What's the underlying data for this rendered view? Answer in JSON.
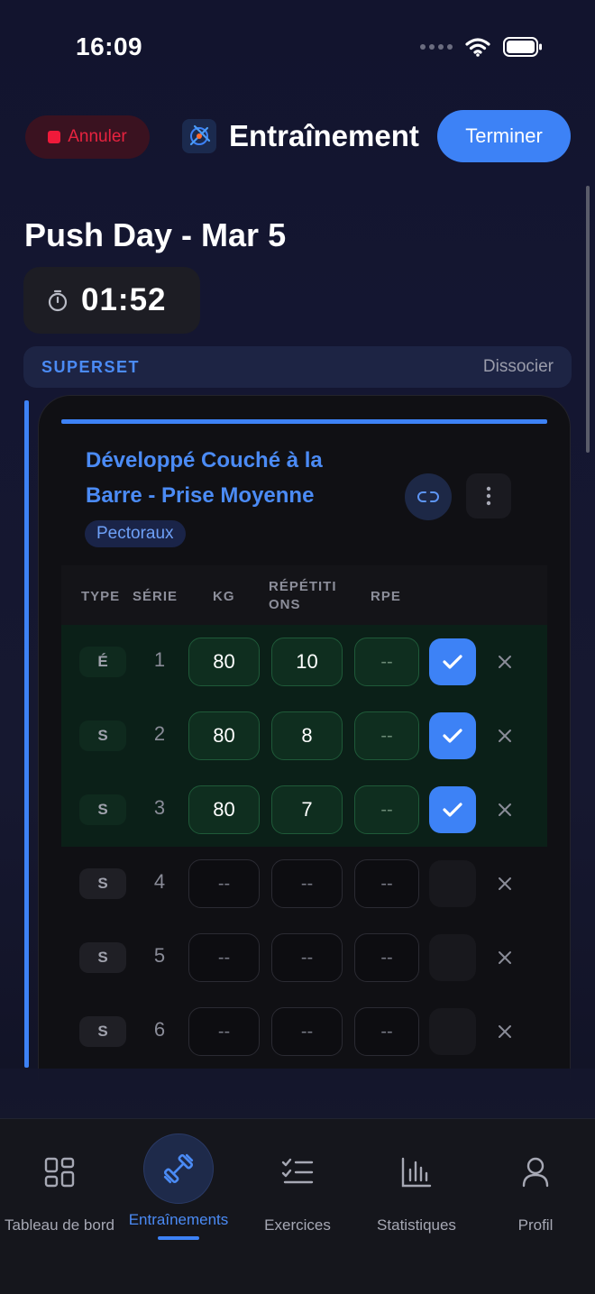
{
  "status_bar": {
    "time": "16:09"
  },
  "header": {
    "cancel_label": "Annuler",
    "title": "Entraînement",
    "finish_label": "Terminer"
  },
  "workout": {
    "title": "Push Day - Mar 5",
    "timer": "01:52"
  },
  "superset": {
    "label": "SUPERSET",
    "dissociate_label": "Dissocier"
  },
  "exercise": {
    "name": "Développé Couché à la Barre - Prise Moyenne",
    "muscle": "Pectoraux",
    "columns": {
      "type": "TYPE",
      "set": "SÉRIE",
      "kg": "KG",
      "reps_line1": "RÉPÉTITI",
      "reps_line2": "ONS",
      "rpe": "RPE"
    },
    "sets": [
      {
        "type": "É",
        "number": "1",
        "kg": "80",
        "reps": "10",
        "rpe": "--",
        "done": true
      },
      {
        "type": "S",
        "number": "2",
        "kg": "80",
        "reps": "8",
        "rpe": "--",
        "done": true
      },
      {
        "type": "S",
        "number": "3",
        "kg": "80",
        "reps": "7",
        "rpe": "--",
        "done": true
      },
      {
        "type": "S",
        "number": "4",
        "kg": "--",
        "reps": "--",
        "rpe": "--",
        "done": false
      },
      {
        "type": "S",
        "number": "5",
        "kg": "--",
        "reps": "--",
        "rpe": "--",
        "done": false
      },
      {
        "type": "S",
        "number": "6",
        "kg": "--",
        "reps": "--",
        "rpe": "--",
        "done": false
      }
    ]
  },
  "tabbar": {
    "items": [
      {
        "label": "Tableau de bord",
        "icon": "dashboard-icon"
      },
      {
        "label": "Entraînements",
        "icon": "dumbbell-icon",
        "active": true
      },
      {
        "label": "Exercices",
        "icon": "checklist-icon"
      },
      {
        "label": "Statistiques",
        "icon": "bar-chart-icon"
      },
      {
        "label": "Profil",
        "icon": "profile-icon"
      }
    ]
  },
  "colors": {
    "accent": "#3d82f6",
    "cancel": "#e8233f",
    "done_row": "#0b2018"
  }
}
